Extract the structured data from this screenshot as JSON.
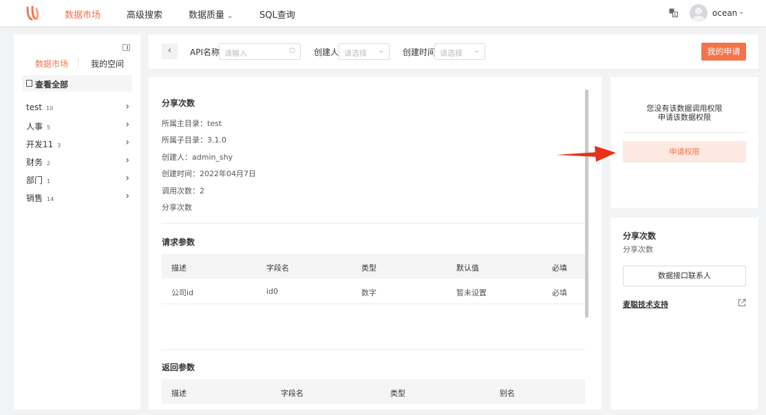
{
  "nav": {
    "items": [
      {
        "label": "数据市场",
        "active": true
      },
      {
        "label": "高级搜索",
        "active": false
      },
      {
        "label": "数据质量",
        "active": false
      },
      {
        "label": "SQL查询",
        "active": false
      }
    ],
    "user_name": "ocean",
    "accent_color": "#f2744a"
  },
  "sidebar": {
    "tabs": [
      {
        "label": "数据市场"
      },
      {
        "label": "我的空间"
      }
    ],
    "view_all": "查看全部",
    "categories": [
      {
        "name": "test",
        "count": "10"
      },
      {
        "name": "人事",
        "count": "5"
      },
      {
        "name": "开发11",
        "count": "3"
      },
      {
        "name": "财务",
        "count": "2"
      },
      {
        "name": "部门",
        "count": "1"
      },
      {
        "name": "销售",
        "count": "14"
      }
    ]
  },
  "filters": {
    "api_name_label": "API名称",
    "api_name_placeholder": "请输入",
    "creator_label": "创建人",
    "creator_placeholder": "请选择",
    "created_time_label": "创建时间",
    "created_time_placeholder": "请选择",
    "my_apply_button": "我的申请"
  },
  "detail": {
    "title": "分享次数",
    "info": [
      "所属主目录：test",
      "所属子目录：3.1.0",
      "创建人：admin_shy",
      "创建时间：2022年04月7日",
      "调用次数：2",
      "分享次数"
    ],
    "request_params": {
      "title": "请求参数",
      "headers": [
        "描述",
        "字段名",
        "类型",
        "默认值",
        "必填"
      ],
      "rows": [
        [
          "公司id",
          "id0",
          "数字",
          "暂未设置",
          "必填"
        ]
      ]
    },
    "return_params": {
      "title": "返回参数",
      "headers": [
        "描述",
        "字段名",
        "类型",
        "别名"
      ]
    }
  },
  "permission": {
    "line1": "您没有该数据调用权限",
    "line2": "申请该数据权限",
    "apply_button": "申请权限"
  },
  "contact": {
    "title": "分享次数",
    "subtitle": "分享次数",
    "contact_button": "数据接口联系人",
    "support_link": "麦聪技术支持"
  }
}
